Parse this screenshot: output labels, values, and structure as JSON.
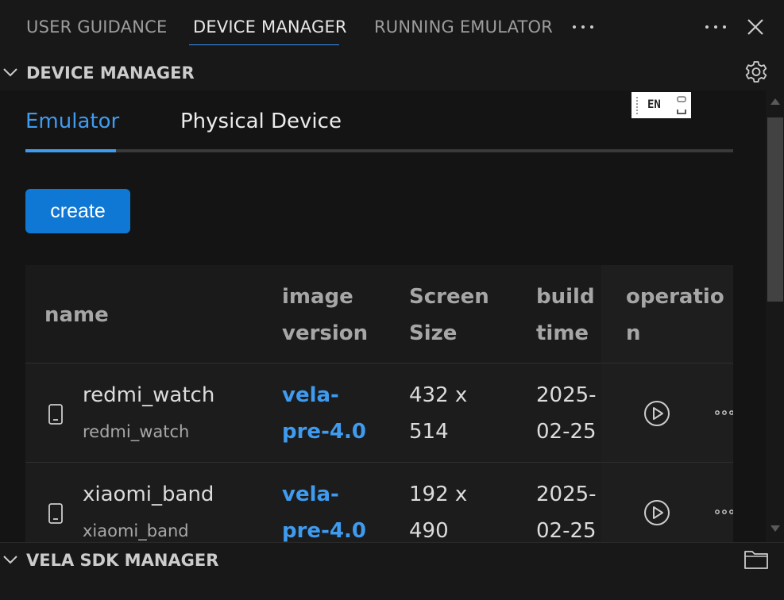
{
  "panel_tabs": [
    {
      "label": "USER GUIDANCE"
    },
    {
      "label": "DEVICE MANAGER"
    },
    {
      "label": "RUNNING EMULATOR"
    }
  ],
  "more_tabs_icon": "ellipsis-icon",
  "panel_actions": {
    "more_icon": "ellipsis-icon",
    "close_icon": "close-icon"
  },
  "device_section": {
    "title": "DEVICE MANAGER",
    "settings_icon": "gear-icon"
  },
  "ime_indicator": {
    "label": "EN"
  },
  "emulator_tabs": [
    {
      "label": "Emulator",
      "active": true
    },
    {
      "label": "Physical Device",
      "active": false
    }
  ],
  "create_button": {
    "label": "create"
  },
  "table": {
    "headers": {
      "name": "name",
      "image_version": [
        "image",
        "version"
      ],
      "screen_size": [
        "Screen",
        "Size"
      ],
      "build_time": [
        "build",
        "time"
      ],
      "operation": [
        "operatio",
        "n"
      ]
    },
    "rows": [
      {
        "name": "redmi_watch",
        "sub_name": "redmi_watch",
        "image_version": [
          "vela-",
          "pre-4.0"
        ],
        "screen_size": [
          "432 x",
          "514"
        ],
        "build_time": [
          "2025-",
          "02-25"
        ],
        "device_icon": "phone-icon",
        "play_icon": "play-icon",
        "more_icon": "ellipsis-icon"
      },
      {
        "name": "xiaomi_band",
        "sub_name": "xiaomi_band",
        "image_version": [
          "vela-",
          "pre-4.0"
        ],
        "screen_size": [
          "192 x",
          "490"
        ],
        "build_time": [
          "2025-",
          "02-25"
        ],
        "device_icon": "phone-icon",
        "play_icon": "play-icon",
        "more_icon": "ellipsis-icon"
      }
    ]
  },
  "sdk_section": {
    "title": "VELA SDK MANAGER",
    "folder_icon": "folder-icon"
  },
  "colors": {
    "accent": "#3f9bf0",
    "button": "#0f78d4",
    "background": "#181818"
  }
}
